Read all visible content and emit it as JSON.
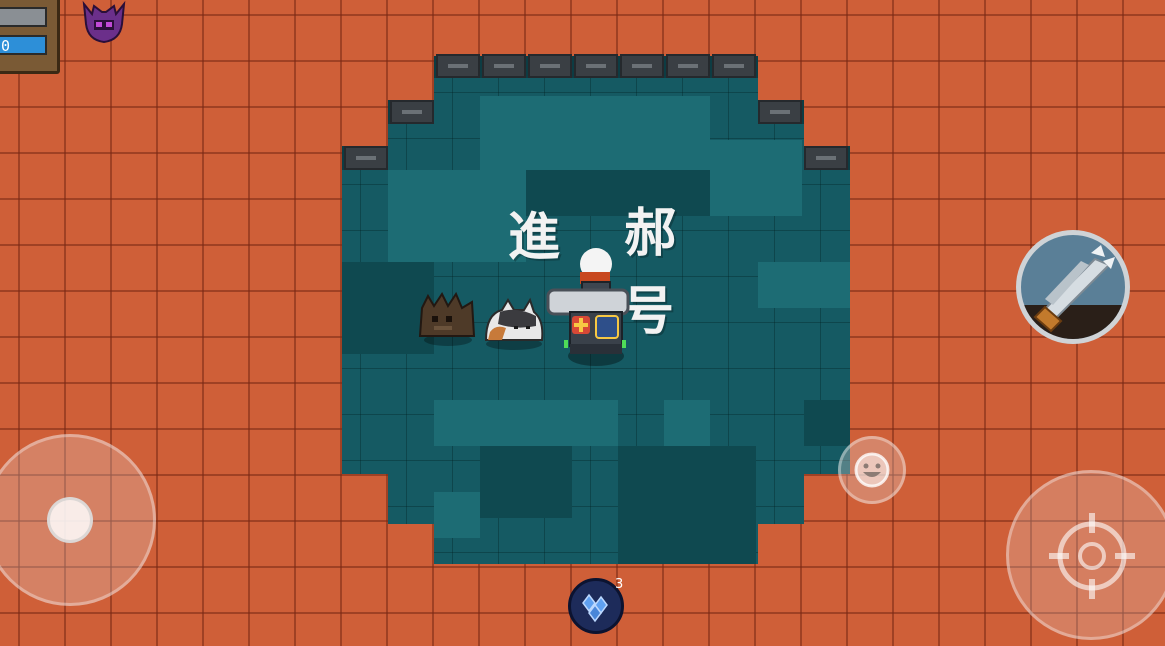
{
  "hud": {
    "energy_value": "0",
    "boss_icon": "demon-helmet-icon"
  },
  "controls": {
    "movement": "movement-joystick",
    "attack": "crosshair-icon",
    "weapon": "crossbow-weapon-icon",
    "emote": "smiley-face-icon",
    "skill": "crystal-skill-icon",
    "skill_charges": "3"
  },
  "floating_text": [
    "進",
    "郝",
    "号"
  ],
  "colors": {
    "floor": "#cf5f38",
    "room": "#155a63",
    "energy_bar": "#2d8fd8",
    "hp_bar": "#8a8a8a"
  }
}
